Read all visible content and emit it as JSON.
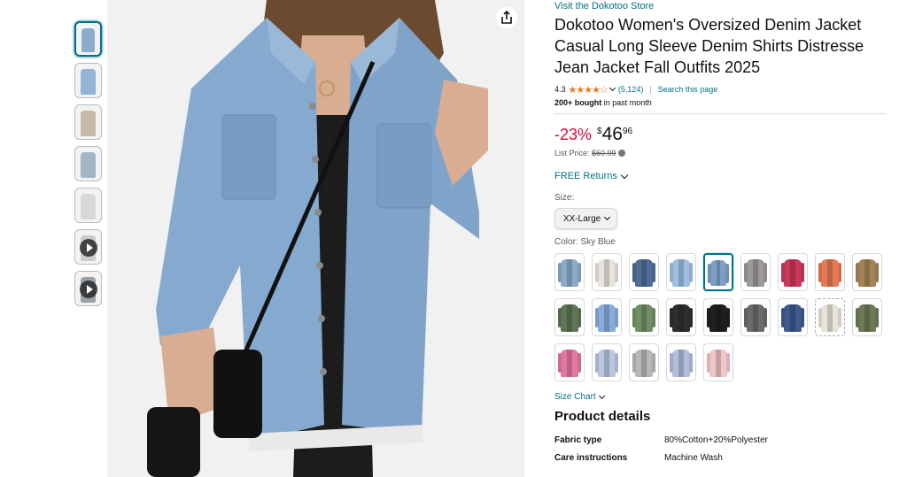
{
  "store": {
    "link": "Visit the Dokotoo Store"
  },
  "product": {
    "title": "Dokotoo Women's Oversized Denim Jacket Casual Long Sleeve Denim Shirts Distresse Jean Jacket Fall Outfits 2025",
    "rating": "4.3",
    "stars": "★★★★☆",
    "reviews": "(5,124)",
    "search_page": "Search this page",
    "bought_bold": "200+ bought",
    "bought_rest": " in past month"
  },
  "price": {
    "discount": "-23%",
    "currency": "$",
    "whole": "46",
    "fraction": "96",
    "list_label": "List Price: ",
    "list_value": "$60.99"
  },
  "returns": {
    "label": "FREE Returns"
  },
  "size": {
    "label": "Size:",
    "selected": "XX-Large"
  },
  "color": {
    "label": "Color: Sky Blue",
    "swatches": [
      "#8aaac9",
      "#e8e4dc",
      "#4f6c96",
      "#9fbfe0",
      "#7d9fc6",
      "#9d9a98",
      "#c9385a",
      "#e57a55",
      "#a48457",
      "#5d7656",
      "#86addb",
      "#6f8f64",
      "#2e2e2e",
      "#1f1f1f",
      "#6b6b6b",
      "#3f5a8c",
      "#e8e4da",
      "#6e7a55",
      "#e2789f",
      "#b8c6e0",
      "#b8b8b8",
      "#b4bedb",
      "#f0c6c9"
    ]
  },
  "size_chart": {
    "label": "Size Chart"
  },
  "details": {
    "title": "Product details",
    "rows": [
      {
        "key": "Fabric type",
        "value": "80%Cotton+20%Polyester"
      },
      {
        "key": "Care instructions",
        "value": "Machine Wash"
      }
    ]
  },
  "thumbnails": [
    {
      "color": "#8aaccf",
      "type": "image"
    },
    {
      "color": "#93b4d6",
      "type": "image"
    },
    {
      "color": "#c9b9a8",
      "type": "image"
    },
    {
      "color": "#a3b6c7",
      "type": "image"
    },
    {
      "color": "#d8d8d8",
      "type": "image"
    },
    {
      "color": "#cccccc",
      "type": "video"
    },
    {
      "color": "#9aa1a6",
      "type": "video"
    }
  ],
  "colors": {
    "link": "#007185",
    "discount": "#cc0c39",
    "star": "#de7921",
    "denim": "#86a9cf",
    "skin": "#d9ad91",
    "hair": "#6b4a30"
  }
}
